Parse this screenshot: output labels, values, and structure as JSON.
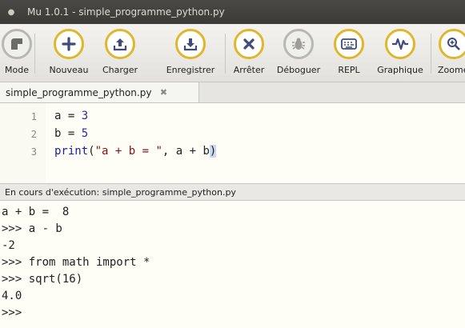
{
  "window": {
    "title": "Mu 1.0.1 - simple_programme_python.py"
  },
  "toolbar": {
    "buttons": [
      {
        "label": "Mode",
        "icon": "mode-icon"
      },
      {
        "label": "Nouveau",
        "icon": "plus-icon"
      },
      {
        "label": "Charger",
        "icon": "upload-icon"
      },
      {
        "label": "Enregistrer",
        "icon": "download-icon"
      },
      {
        "label": "Arrêter",
        "icon": "close-icon"
      },
      {
        "label": "Déboguer",
        "icon": "bug-icon"
      },
      {
        "label": "REPL",
        "icon": "keyboard-icon"
      },
      {
        "label": "Graphique",
        "icon": "pulse-icon"
      },
      {
        "label": "Zoomer",
        "icon": "zoom-in-icon"
      }
    ]
  },
  "tabs": [
    {
      "label": "simple_programme_python.py"
    }
  ],
  "editor": {
    "lines": [
      {
        "number": "1",
        "code": "a = 3"
      },
      {
        "number": "2",
        "code": "b = 5"
      },
      {
        "number": "3",
        "code": "print(\"a + b = \", a + b)"
      }
    ]
  },
  "run_status": "En cours d'exécution: simple_programme_python.py",
  "console": {
    "lines": [
      "a + b =  8",
      ">>> a - b",
      "-2",
      ">>> from math import *",
      ">>> sqrt(16)",
      "4.0",
      ">>> "
    ]
  },
  "colors": {
    "accent": "#e0b72c",
    "titlebar": "#3b3a36",
    "editor_background": "#fefef7"
  }
}
